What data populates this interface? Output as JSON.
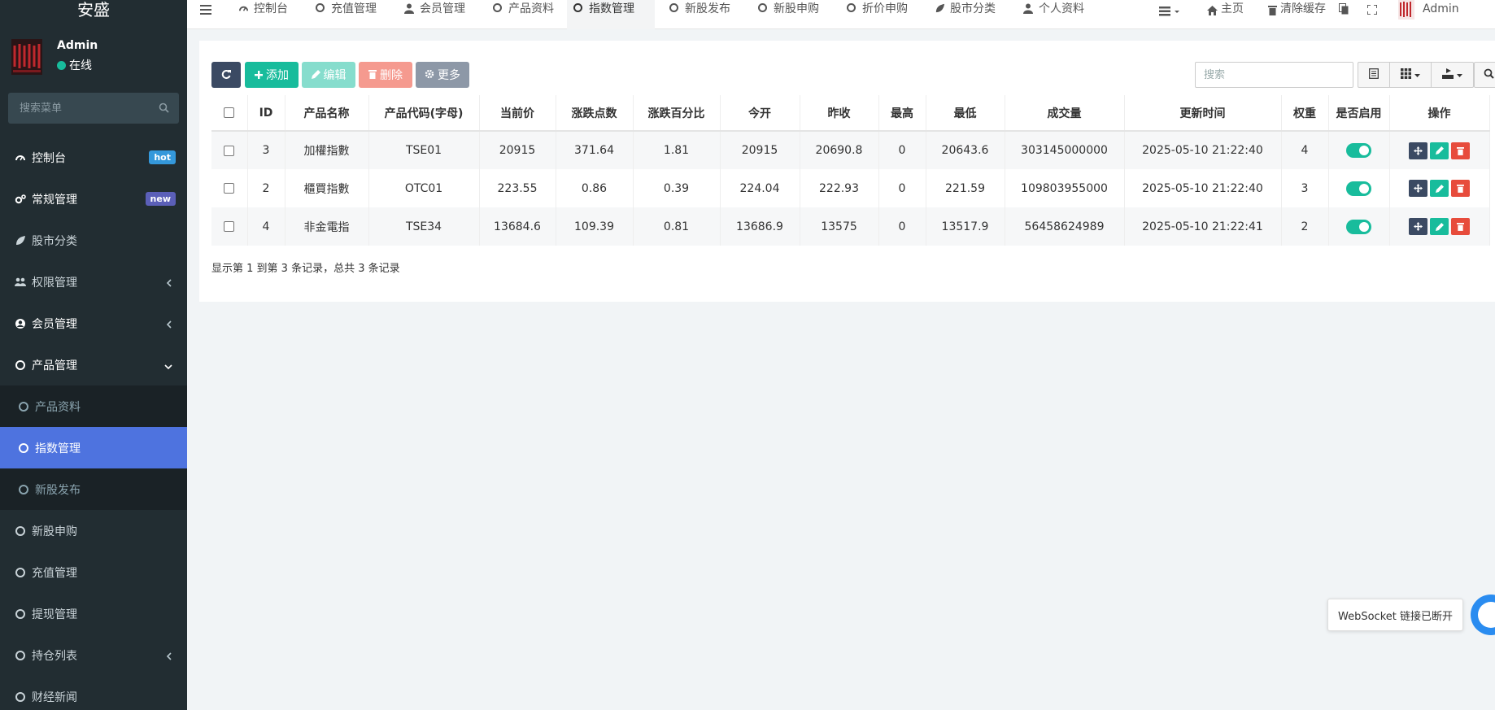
{
  "app": {
    "logo_text": "安盛"
  },
  "user": {
    "name": "Admin",
    "status": "在线"
  },
  "sidebar": {
    "search_placeholder": "搜索菜单",
    "items": [
      {
        "label": "控制台",
        "badge": "hot",
        "icon": "dashboard-icon"
      },
      {
        "label": "常规管理",
        "badge": "new",
        "icon": "cogs-icon"
      },
      {
        "label": "股市分类",
        "icon": "leaf-icon"
      },
      {
        "label": "权限管理",
        "icon": "users-icon"
      },
      {
        "label": "会员管理",
        "icon": "user-circle-icon"
      },
      {
        "label": "产品管理",
        "icon": "circle-icon"
      }
    ],
    "sub_items": [
      {
        "label": "产品资料"
      },
      {
        "label": "指数管理"
      },
      {
        "label": "新股发布"
      }
    ],
    "items_after": [
      {
        "label": "新股申购"
      },
      {
        "label": "充值管理"
      },
      {
        "label": "提现管理"
      },
      {
        "label": "持仓列表"
      },
      {
        "label": "财经新闻"
      }
    ]
  },
  "topnav": {
    "tabs": [
      {
        "label": "控制台",
        "icon": "dashboard-icon"
      },
      {
        "label": "充值管理",
        "icon": "circle-icon"
      },
      {
        "label": "会员管理",
        "icon": "user-icon"
      },
      {
        "label": "产品资料",
        "icon": "circle-icon"
      },
      {
        "label": "指数管理",
        "icon": "circle-icon",
        "active": true
      },
      {
        "label": "新股发布",
        "icon": "circle-icon"
      },
      {
        "label": "新股申购",
        "icon": "circle-icon"
      },
      {
        "label": "折价申购",
        "icon": "circle-icon"
      },
      {
        "label": "股市分类",
        "icon": "leaf-icon"
      },
      {
        "label": "个人资料",
        "icon": "user-icon"
      }
    ],
    "home": "主页",
    "clear_cache": "清除缓存",
    "admin": "Admin"
  },
  "toolbar": {
    "add": "添加",
    "edit": "编辑",
    "delete": "删除",
    "more": "更多",
    "search_placeholder": "搜索"
  },
  "table": {
    "columns": [
      "ID",
      "产品名称",
      "产品代码(字母)",
      "当前价",
      "涨跌点数",
      "涨跌百分比",
      "今开",
      "昨收",
      "最高",
      "最低",
      "成交量",
      "更新时间",
      "权重",
      "是否启用",
      "操作"
    ],
    "rows": [
      [
        "3",
        "加權指數",
        "TSE01",
        "20915",
        "371.64",
        "1.81",
        "20915",
        "20690.8",
        "0",
        "20643.6",
        "303145000000",
        "2025-05-10 21:22:40",
        "4"
      ],
      [
        "2",
        "櫃買指數",
        "OTC01",
        "223.55",
        "0.86",
        "0.39",
        "224.04",
        "222.93",
        "0",
        "221.59",
        "109803955000",
        "2025-05-10 21:22:40",
        "3"
      ],
      [
        "4",
        "非金電指",
        "TSE34",
        "13684.6",
        "109.39",
        "0.81",
        "13686.9",
        "13575",
        "0",
        "13517.9",
        "56458624989",
        "2025-05-10 21:22:41",
        "2"
      ]
    ],
    "enabled": [
      true,
      true,
      true
    ]
  },
  "pagination": {
    "info": "显示第 1 到第 3 条记录，总共 3 条记录"
  },
  "websocket": {
    "message": "WebSocket 链接已断开"
  },
  "colors": {
    "sidebar_bg": "#222d32",
    "active_menu": "#4e73df",
    "success": "#18bc9c",
    "danger": "#e74c3c",
    "primary_dark": "#3b4a63"
  }
}
